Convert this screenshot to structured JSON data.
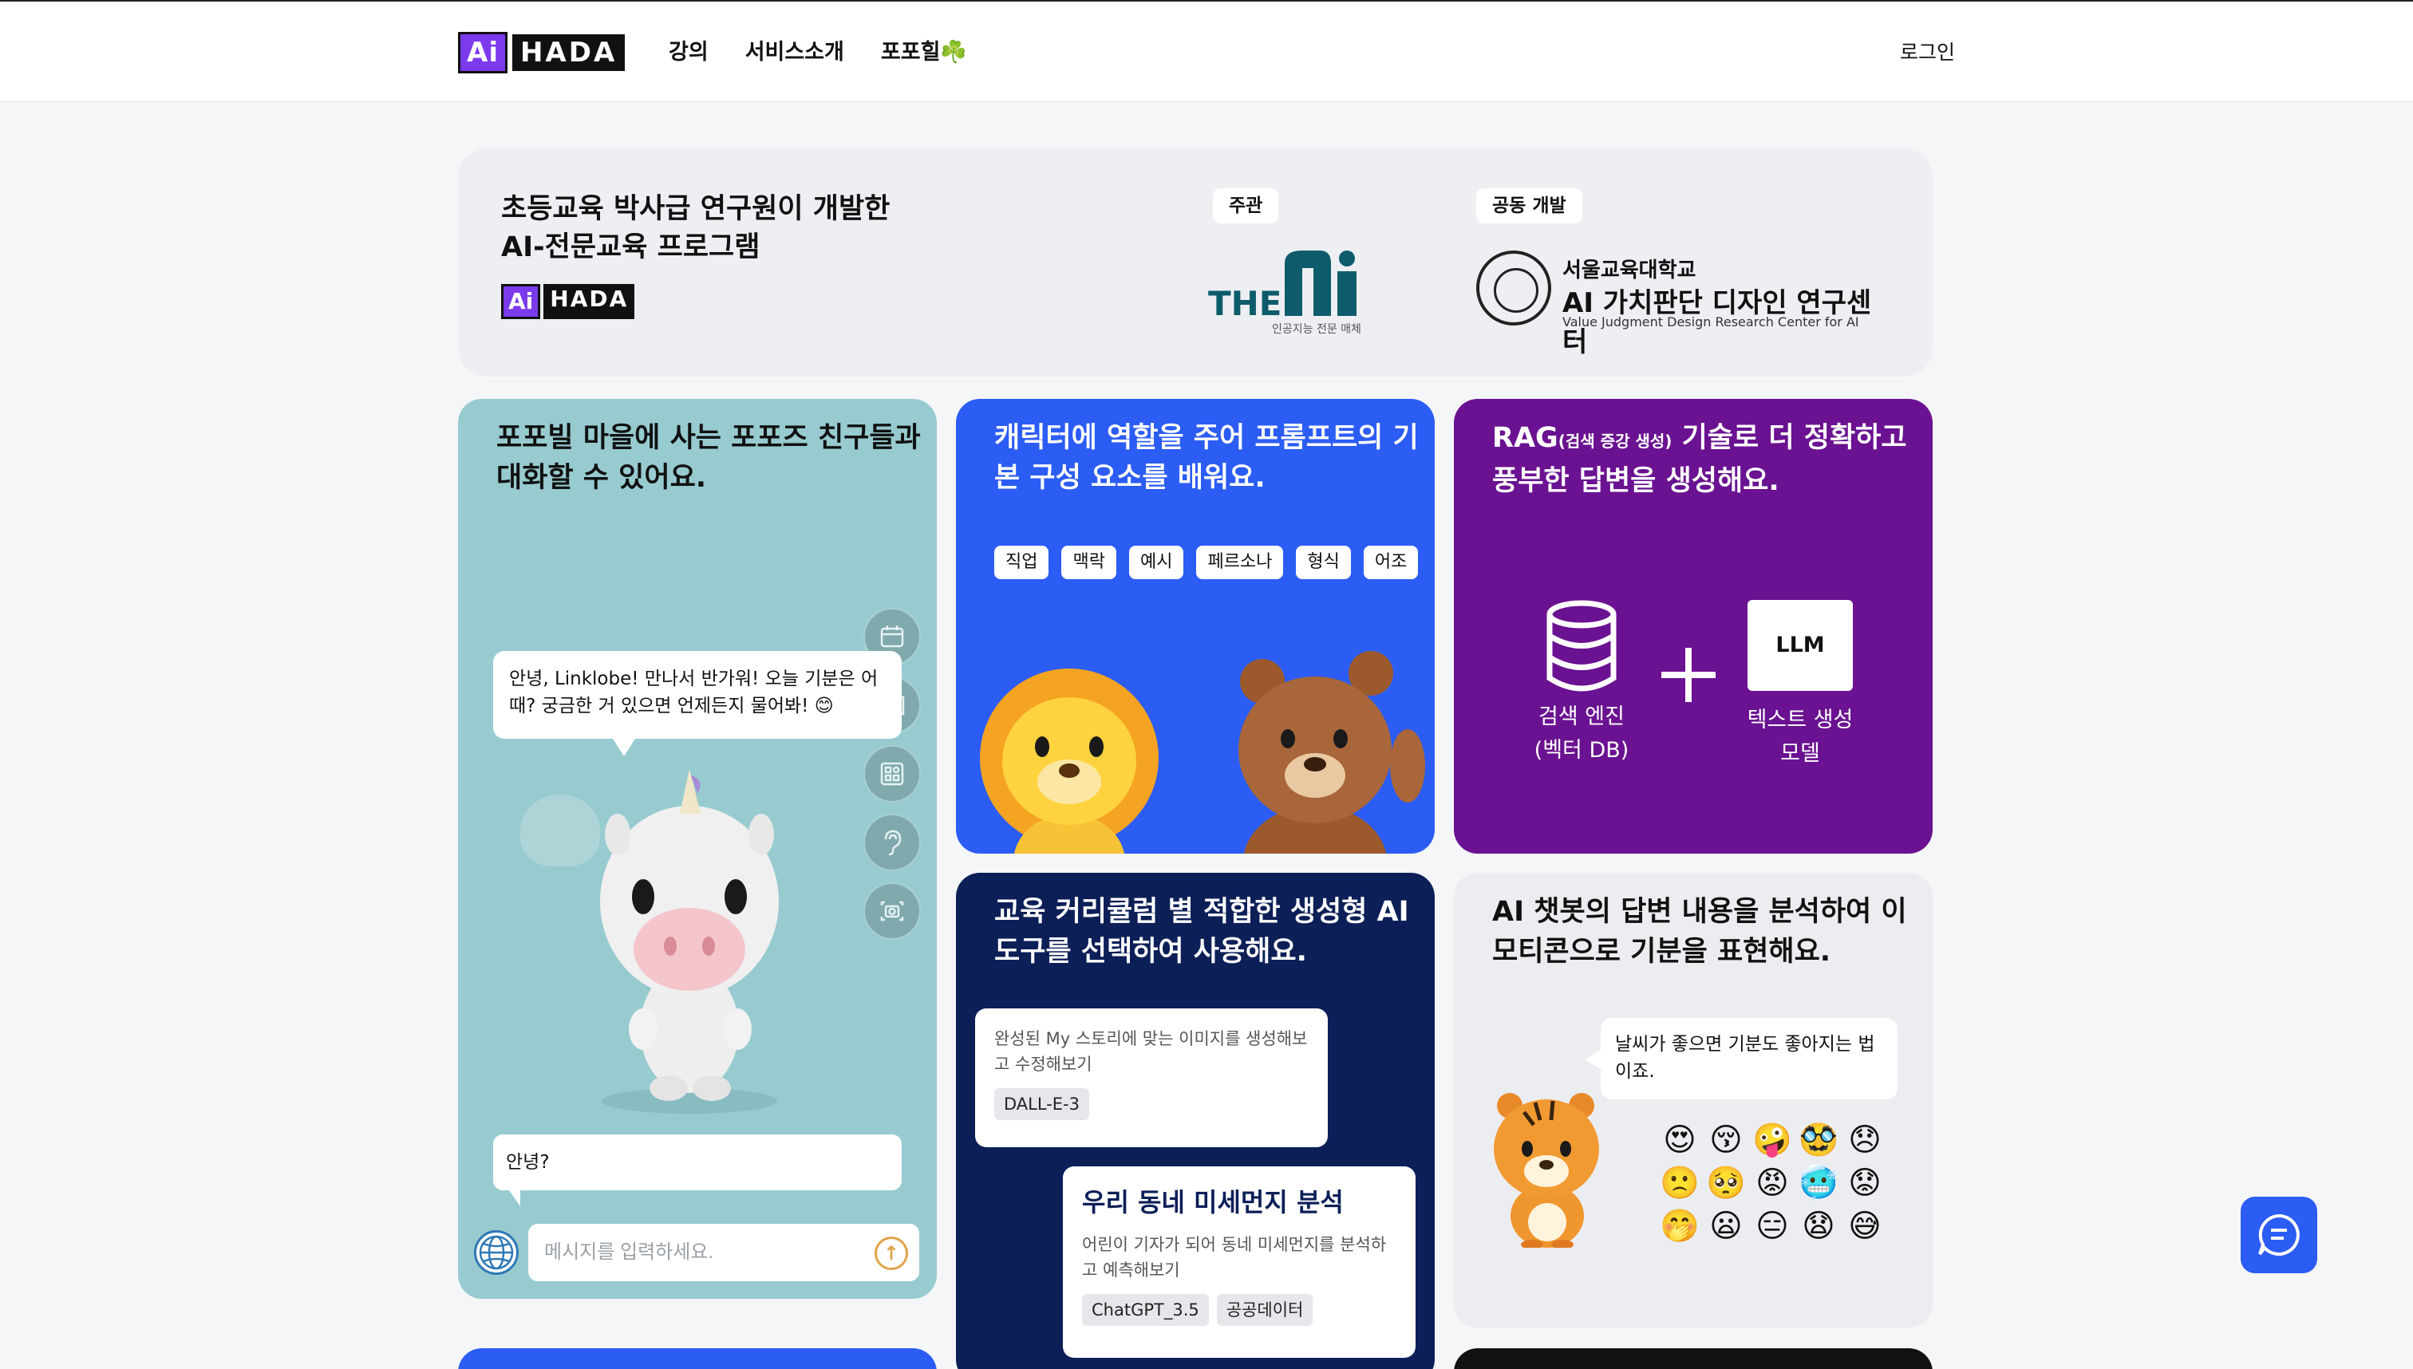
{
  "header": {
    "logo": {
      "ai": "Ai",
      "hada": "HADA"
    },
    "nav": [
      {
        "label": "강의"
      },
      {
        "label": "서비스소개"
      },
      {
        "label": "포포힐☘️"
      }
    ],
    "login": "로그인"
  },
  "banner": {
    "title": "초등교육 박사급 연구원이 개발한\nAI-전문교육 프로그램",
    "host_label": "주관",
    "codev_label": "공동 개발",
    "partner1": {
      "main": "THE",
      "caption": "인공지능 전문 매체"
    },
    "partner2": {
      "name": "서울교육대학교",
      "center": "AI 가치판단 디자인 연구센터",
      "english": "Value Judgment Design Research Center for AI"
    }
  },
  "cards": {
    "popoville": {
      "title": "포포빌 마을에 사는 포포즈 친구들과 대화할 수 있어요.",
      "bot_message": "안녕, Linklobe! 만나서 반가워! 오늘 기분은 어때? 궁금한 거 있으면 언제든지 물어봐! 😊",
      "user_message": "안녕?",
      "input_placeholder": "메시지를 입력하세요.",
      "side_icons": [
        "calendar-icon",
        "book-icon",
        "apps-icon",
        "ear-icon",
        "camera-icon"
      ]
    },
    "prompt": {
      "title": "캐릭터에 역할을 주어 프롬프트의 기본 구성 요소를 배워요.",
      "tags": [
        "직업",
        "맥락",
        "예시",
        "페르소나",
        "형식",
        "어조"
      ]
    },
    "rag": {
      "title_main": "RAG",
      "title_small": "(검색 증강 생성)",
      "title_rest": " 기술로 더 정확하고 풍부한 답변을 생성해요.",
      "db_label": "검색 엔진\n(벡터 DB)",
      "llm_box": "LLM",
      "llm_label": "텍스트 생성\n모델"
    },
    "tools": {
      "title": "교육 커리큘럼 별 적합한 생성형 AI 도구를 선택하여 사용해요.",
      "tool_a": {
        "desc": "완성된 My 스토리에 맞는 이미지를 생성해보고 수정해보기",
        "chips": [
          "DALL-E-3"
        ]
      },
      "tool_b": {
        "name": "우리 동네 미세먼지 분석",
        "desc": "어린이 기자가 되어 동네 미세먼지를 분석하고 예측해보기",
        "chips": [
          "ChatGPT_3.5",
          "공공데이터"
        ]
      }
    },
    "emotion": {
      "title": "AI 챗봇의 답변 내용을 분석하여 이모티콘으로 기분을 표현해요.",
      "bubble": "날씨가 좋으면 기분도 좋아지는 법이죠.",
      "emojis": [
        "😍",
        "😚",
        "🤪",
        "🥸",
        "😞",
        "🙁",
        "🥺",
        "😡",
        "🥶",
        "😟",
        "🤭",
        "😦",
        "😑",
        "😧",
        "😅"
      ]
    }
  },
  "colors": {
    "blue": "#2b5cf4",
    "purple": "#6a1291",
    "navy": "#0c1f57",
    "teal": "#97cbd0"
  }
}
